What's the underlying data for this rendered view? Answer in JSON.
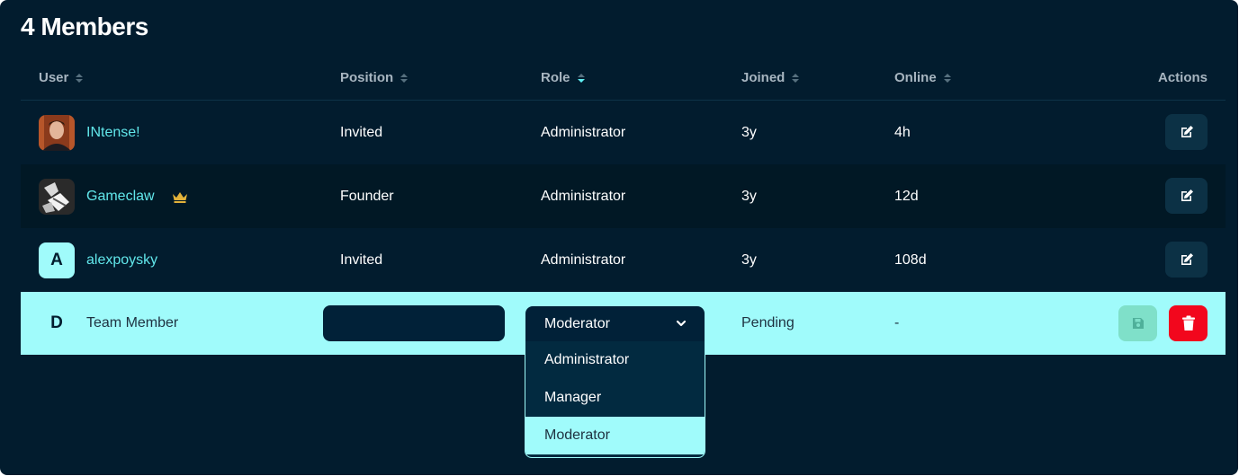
{
  "title": "4 Members",
  "columns": {
    "user": "User",
    "position": "Position",
    "role": "Role",
    "joined": "Joined",
    "online": "Online",
    "actions": "Actions"
  },
  "sorted_column": "role",
  "members": [
    {
      "name": "INtense!",
      "position": "Invited",
      "role": "Administrator",
      "joined": "3y",
      "online": "4h",
      "avatar": "photo"
    },
    {
      "name": "Gameclaw",
      "position": "Founder",
      "role": "Administrator",
      "joined": "3y",
      "online": "12d",
      "avatar": "photo",
      "badge": "crown-icon"
    },
    {
      "name": "alexpoysky",
      "position": "Invited",
      "role": "Administrator",
      "joined": "3y",
      "online": "108d",
      "avatar_letter": "A"
    }
  ],
  "editing_member": {
    "avatar_letter": "D",
    "name": "Team Member",
    "position_value": "",
    "role_selected": "Moderator",
    "joined": "Pending",
    "online": "-"
  },
  "role_options": [
    "Administrator",
    "Manager",
    "Moderator"
  ],
  "colors": {
    "background": "#021c2e",
    "accent": "#a0fbfb",
    "username": "#61e6ea",
    "delete": "#f2071d",
    "save": "#7fe0c9",
    "crown": "#e2b23a"
  }
}
